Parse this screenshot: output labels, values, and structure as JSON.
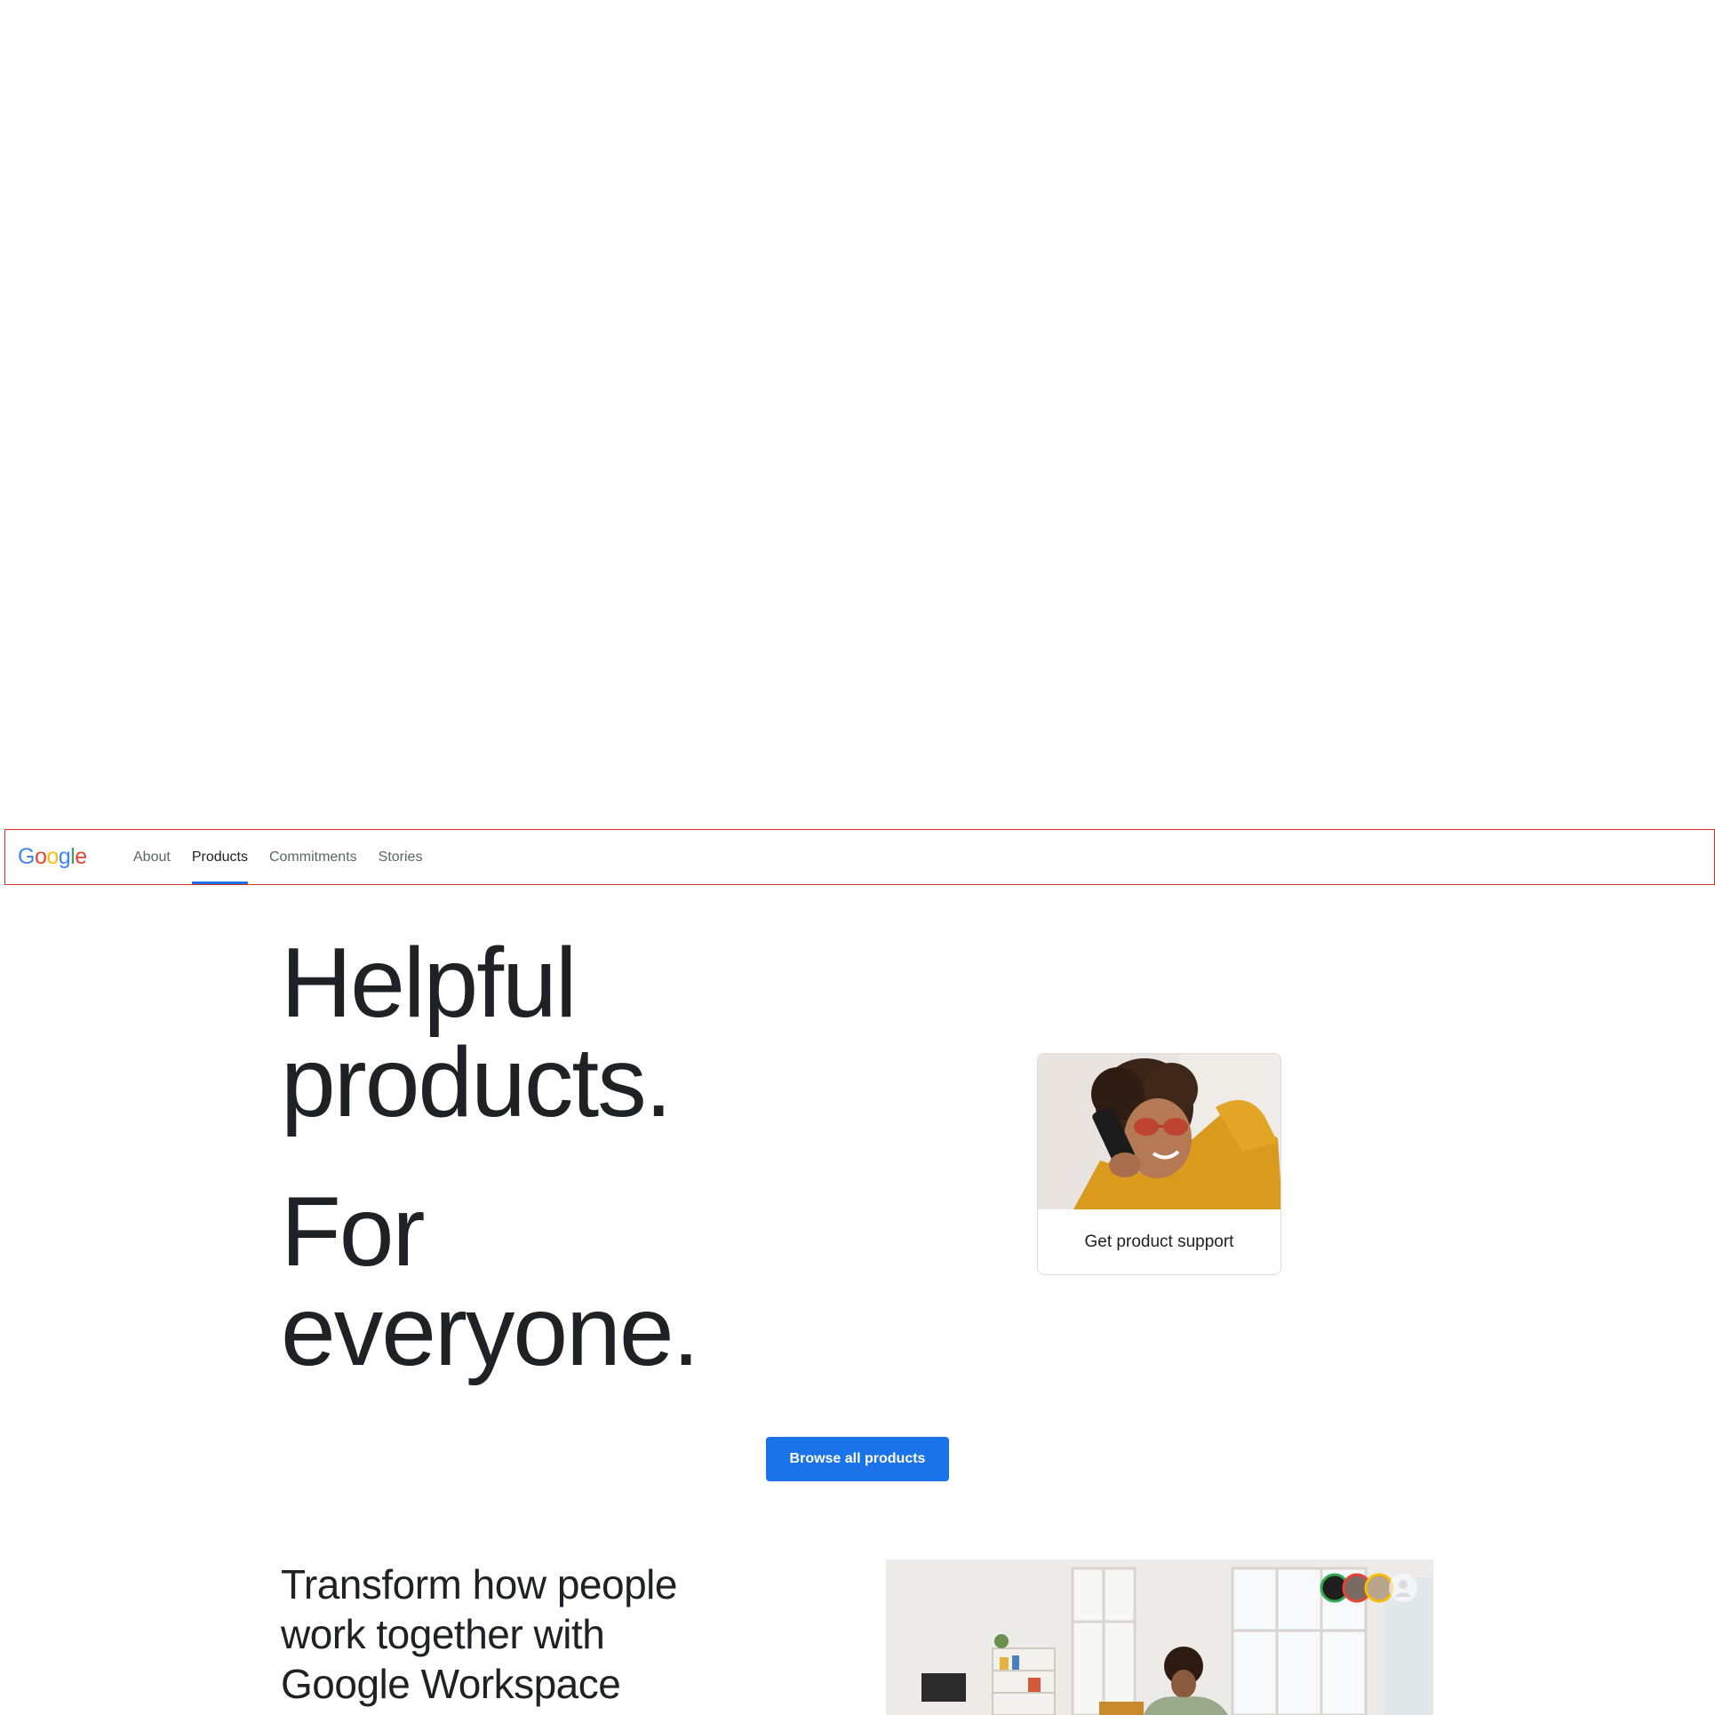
{
  "header": {
    "logo_letters": [
      {
        "char": "G",
        "color": "#4285F4"
      },
      {
        "char": "o",
        "color": "#EA4335"
      },
      {
        "char": "o",
        "color": "#FBBC05"
      },
      {
        "char": "g",
        "color": "#4285F4"
      },
      {
        "char": "l",
        "color": "#34A853"
      },
      {
        "char": "e",
        "color": "#EA4335"
      }
    ],
    "nav": [
      {
        "label": "About",
        "active": false
      },
      {
        "label": "Products",
        "active": true
      },
      {
        "label": "Commitments",
        "active": false
      },
      {
        "label": "Stories",
        "active": false
      }
    ],
    "accent_color": "#1a73e8",
    "outline_color": "#d93025"
  },
  "hero": {
    "line1": "Helpful",
    "line2": "products.",
    "line3": "For",
    "line4": "everyone."
  },
  "support_card": {
    "label": "Get product support",
    "image_icon": "person-on-phone-photo"
  },
  "browse_button": {
    "label": "Browse all products",
    "color": "#1a73e8"
  },
  "workspace": {
    "title": "Transform how people work together with Google Workspace",
    "image_icon": "home-office-photo"
  }
}
